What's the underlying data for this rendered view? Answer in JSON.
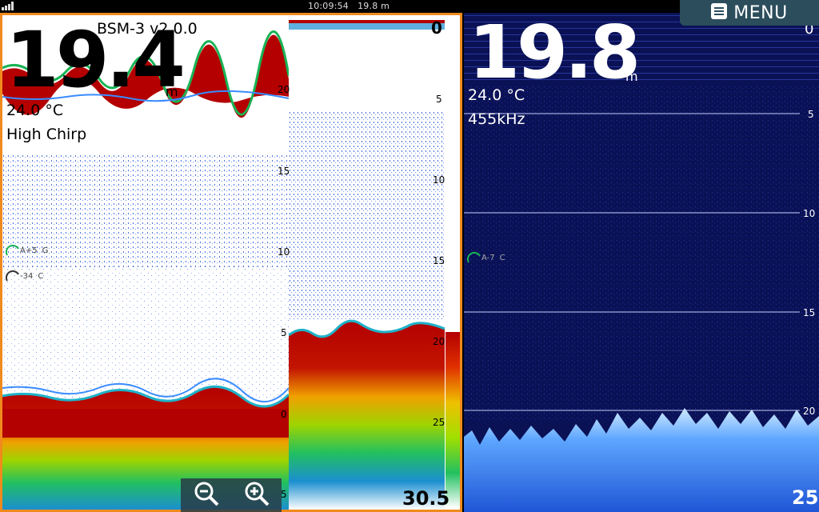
{
  "status": {
    "time": "10:09:54",
    "depth": "19.8 m"
  },
  "menu": {
    "label": "MENU",
    "icon": "menu-icon"
  },
  "left": {
    "title": "BSM-3 v2.0.0",
    "depth": "19.4",
    "unit": "m",
    "temperature": "24.0 °C",
    "mode": "High Chirp",
    "gauge_gain": "A+5",
    "gauge_gain_letter": "G",
    "gauge_color": "-34",
    "gauge_color_letter": "C",
    "history_scale": [
      "20",
      "15",
      "10",
      "5",
      "0",
      "5"
    ],
    "zoom_scale": [
      "0",
      "5",
      "10",
      "15",
      "20",
      "25"
    ],
    "bottom_range": "30.5"
  },
  "right": {
    "depth": "19.8",
    "unit": "m",
    "temperature": "24.0 °C",
    "frequency": "455kHz",
    "gauge_gain": "A-7",
    "gauge_letter": "C",
    "scale": [
      "0",
      "5",
      "10",
      "15",
      "20"
    ],
    "bottom_range": "25"
  },
  "zoom": {
    "out_icon": "zoom-out-icon",
    "in_icon": "zoom-in-icon"
  },
  "colors": {
    "accent_border": "#f08a1c",
    "right_bg": "#0a1155",
    "menu_bg": "#2b4d5c"
  }
}
